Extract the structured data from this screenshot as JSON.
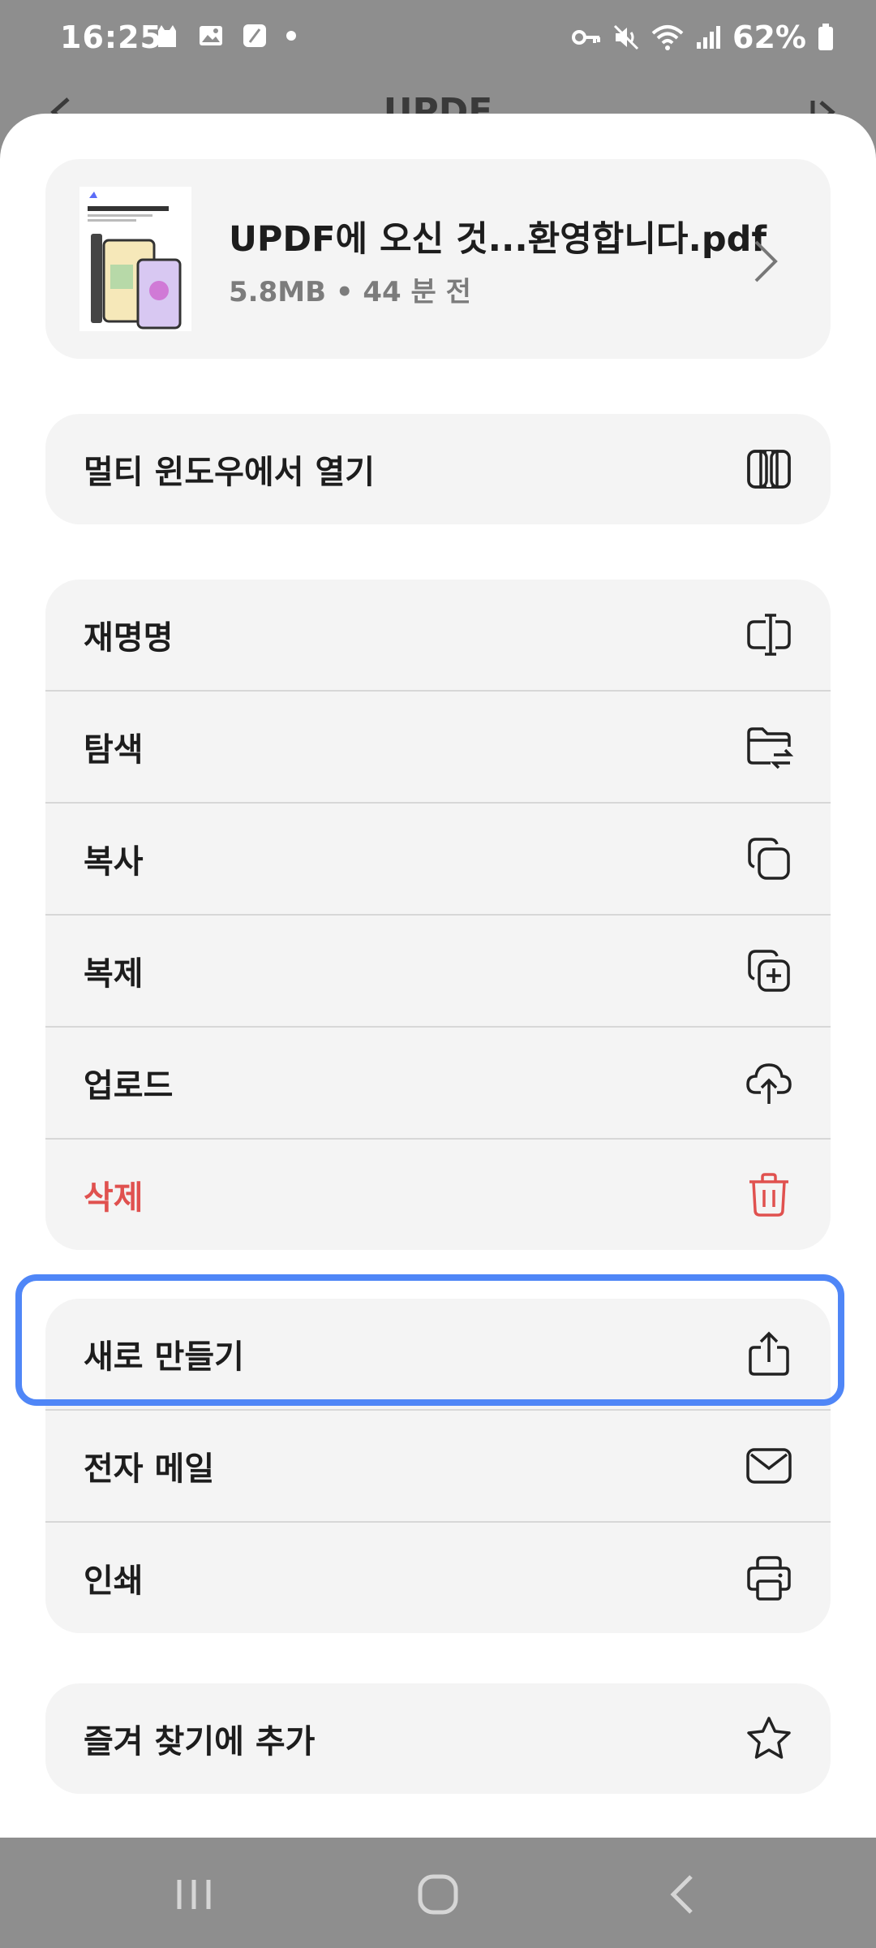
{
  "status_bar": {
    "time": "16:25",
    "battery_percent": "62%",
    "left_icons": [
      "cat-icon",
      "gallery-icon",
      "note-icon",
      "dot-icon"
    ],
    "right_icons": [
      "key-icon",
      "mute-icon",
      "wifi-icon",
      "signal-icon",
      "battery-icon"
    ]
  },
  "background_app": {
    "title": "UPDF"
  },
  "file": {
    "name": "UPDF에 오신 것...환영합니다.pdf",
    "meta": "5.8MB • 44 분 전"
  },
  "menu": {
    "multi_window": {
      "label": "멀티 윈도우에서 열기",
      "icon": "split-window-icon"
    },
    "group1": [
      {
        "label": "재명명",
        "icon": "rename-icon"
      },
      {
        "label": "탐색",
        "icon": "folder-move-icon"
      },
      {
        "label": "복사",
        "icon": "copy-icon"
      },
      {
        "label": "복제",
        "icon": "duplicate-icon"
      },
      {
        "label": "업로드",
        "icon": "cloud-upload-icon"
      },
      {
        "label": "삭제",
        "icon": "trash-icon",
        "color": "#e0514f"
      }
    ],
    "group2": [
      {
        "label": "새로 만들기",
        "icon": "share-icon"
      },
      {
        "label": "전자 메일",
        "icon": "mail-icon"
      },
      {
        "label": "인쇄",
        "icon": "print-icon"
      }
    ],
    "favorite": {
      "label": "즐겨 찾기에 추가",
      "icon": "star-icon"
    }
  },
  "colors": {
    "accent_highlight": "#4f86f7",
    "danger": "#e0514f",
    "card_bg": "#f4f4f4",
    "overlay": "#8e8e8e"
  },
  "navbar": {
    "buttons": [
      "recent-apps-icon",
      "home-icon",
      "back-icon"
    ]
  }
}
